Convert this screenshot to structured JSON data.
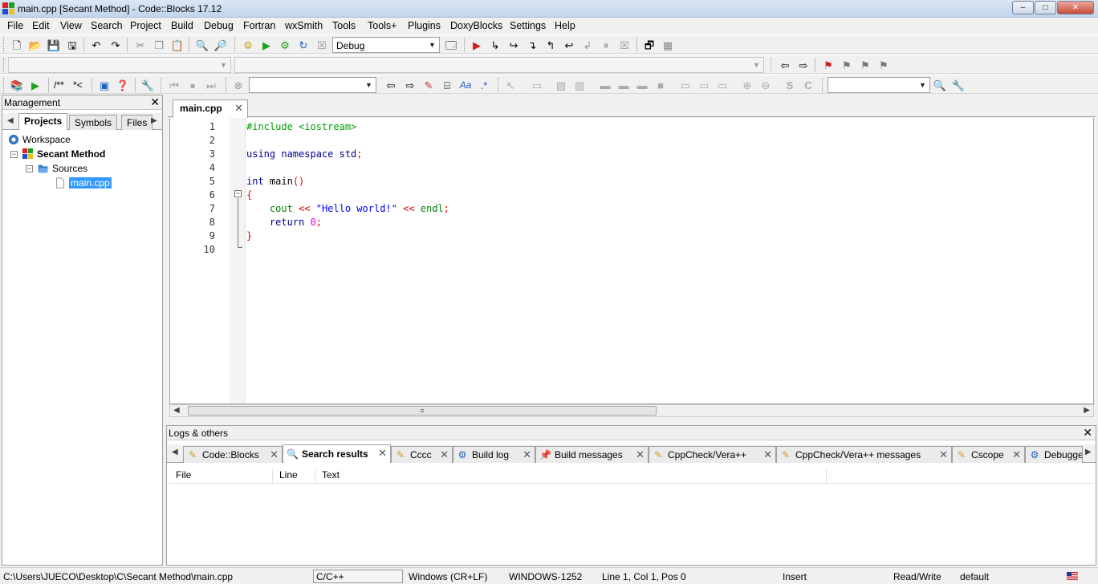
{
  "window": {
    "title": "main.cpp [Secant Method] - Code::Blocks 17.12",
    "minimize": "–",
    "maximize": "□",
    "close": "✕"
  },
  "menu": [
    "File",
    "Edit",
    "View",
    "Search",
    "Project",
    "Build",
    "Debug",
    "Fortran",
    "wxSmith",
    "Tools",
    "Tools+",
    "Plugins",
    "DoxyBlocks",
    "Settings",
    "Help"
  ],
  "toolbar": {
    "build_target": "Debug",
    "doxy_comment_block": "/**",
    "doxy_comment_line": "*<"
  },
  "management": {
    "title": "Management",
    "tabs": [
      "Projects",
      "Symbols",
      "Files"
    ],
    "tree": {
      "workspace": "Workspace",
      "project": "Secant Method",
      "sources": "Sources",
      "file": "main.cpp"
    }
  },
  "editor": {
    "tab_label": "main.cpp",
    "line_numbers": [
      "1",
      "2",
      "3",
      "4",
      "5",
      "6",
      "7",
      "8",
      "9",
      "10"
    ],
    "code": {
      "l1": "#include <iostream>",
      "l3_kw": "using namespace",
      "l3_id": " std",
      "l3_end": ";",
      "l5_kw": "int",
      "l5_id": " main",
      "l5_paren": "()",
      "l6_brace": "{",
      "l7_indent": "    ",
      "l7_cout": "cout",
      "l7_op1": " << ",
      "l7_str": "\"Hello world!\"",
      "l7_op2": " << ",
      "l7_endl": "endl",
      "l7_end": ";",
      "l8_kw": "return",
      "l8_num": "0",
      "l8_end": ";",
      "l9_brace": "}"
    }
  },
  "logs": {
    "title": "Logs & others",
    "tabs": [
      "Code::Blocks",
      "Search results",
      "Cccc",
      "Build log",
      "Build messages",
      "CppCheck/Vera++",
      "CppCheck/Vera++ messages",
      "Cscope",
      "Debugge"
    ],
    "active_tab": "Search results",
    "columns": [
      "File",
      "Line",
      "Text"
    ]
  },
  "status": {
    "path": "C:\\Users\\JUECO\\Desktop\\C\\Secant Method\\main.cpp",
    "language": "C/C++",
    "eol": "Windows (CR+LF)",
    "encoding": "WINDOWS-1252",
    "position": "Line 1, Col 1, Pos 0",
    "mode": "Insert",
    "access": "Read/Write",
    "profile": "default"
  },
  "colors": {
    "keyword": "#00008b",
    "preprocessor": "#00a000",
    "string": "#0000ff",
    "number": "#f000f0",
    "operator": "#e00000",
    "selection": "#3399ff"
  }
}
